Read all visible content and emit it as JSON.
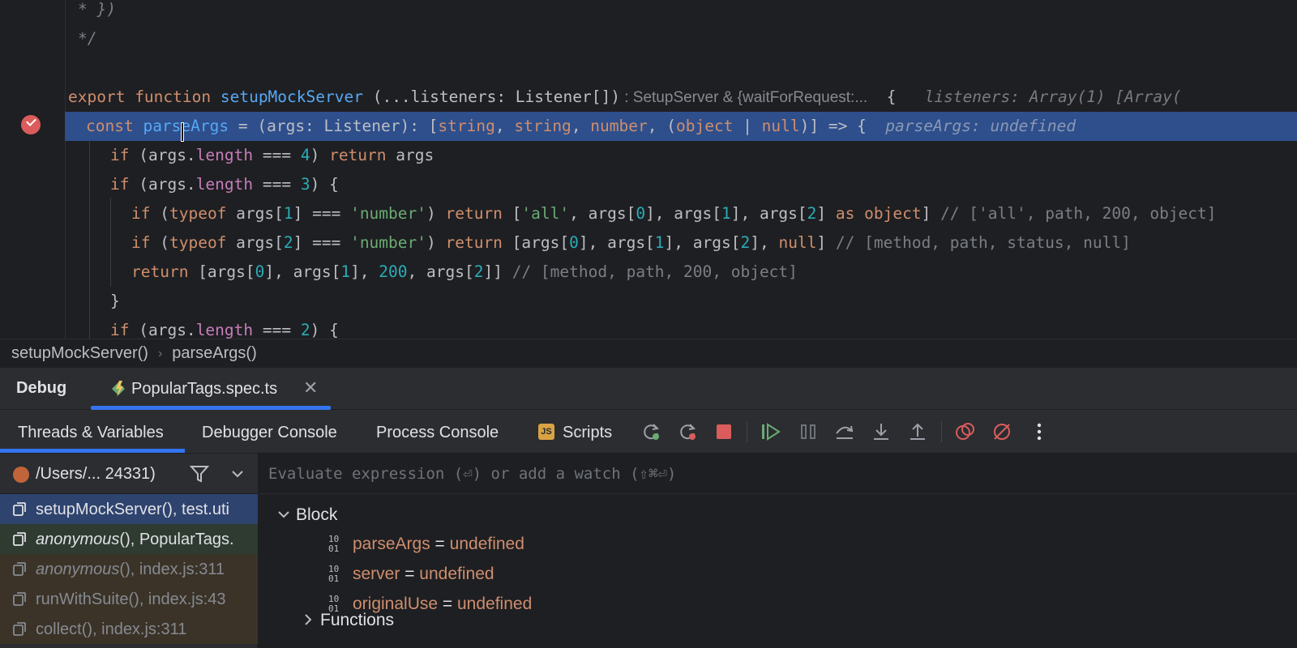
{
  "editor": {
    "lines": [
      {
        "tokens": [
          {
            "t": "* })",
            "c": "cmi"
          }
        ]
      },
      {
        "tokens": [
          {
            "t": "*/",
            "c": "cmi"
          }
        ]
      },
      {
        "tokens": []
      },
      {
        "tokens": [
          {
            "t": "export ",
            "c": "kw"
          },
          {
            "t": "function ",
            "c": "kw"
          },
          {
            "t": "setupMockServer",
            "c": "fn"
          },
          {
            "t": " (...listeners: Listener[])",
            "c": "id"
          },
          {
            "t": " : SetupServer & {waitForRequest:...",
            "c": "inlay"
          },
          {
            "t": "  {",
            "c": "id"
          },
          {
            "t": "   listeners: Array(1) [Array(",
            "c": "dbgval"
          }
        ]
      },
      {
        "tokens": [
          {
            "t": "const ",
            "c": "kw"
          },
          {
            "t": "parseArgs",
            "c": "fn"
          },
          {
            "t": " = ",
            "c": "id"
          },
          {
            "t": "(args: Listener): [",
            "c": "id"
          },
          {
            "t": "string",
            "c": "kw"
          },
          {
            "t": ", ",
            "c": "id"
          },
          {
            "t": "string",
            "c": "kw"
          },
          {
            "t": ", ",
            "c": "id"
          },
          {
            "t": "number",
            "c": "kw"
          },
          {
            "t": ", (",
            "c": "id"
          },
          {
            "t": "object",
            "c": "kw"
          },
          {
            "t": " | ",
            "c": "id"
          },
          {
            "t": "null",
            "c": "kw"
          },
          {
            "t": ")] => {",
            "c": "id"
          },
          {
            "t": "  parseArgs: undefined",
            "c": "dbgval"
          }
        ]
      },
      {
        "tokens": [
          {
            "t": "if ",
            "c": "kw"
          },
          {
            "t": "(args.",
            "c": "id"
          },
          {
            "t": "length",
            "c": "prop"
          },
          {
            "t": " === ",
            "c": "id"
          },
          {
            "t": "4",
            "c": "num"
          },
          {
            "t": ") ",
            "c": "id"
          },
          {
            "t": "return ",
            "c": "kw"
          },
          {
            "t": "args",
            "c": "id"
          }
        ]
      },
      {
        "tokens": [
          {
            "t": "if ",
            "c": "kw"
          },
          {
            "t": "(args.",
            "c": "id"
          },
          {
            "t": "length",
            "c": "prop"
          },
          {
            "t": " === ",
            "c": "id"
          },
          {
            "t": "3",
            "c": "num"
          },
          {
            "t": ") {",
            "c": "id"
          }
        ]
      },
      {
        "tokens": [
          {
            "t": "if ",
            "c": "kw"
          },
          {
            "t": "(",
            "c": "id"
          },
          {
            "t": "typeof ",
            "c": "kw"
          },
          {
            "t": "args[",
            "c": "id"
          },
          {
            "t": "1",
            "c": "num"
          },
          {
            "t": "] === ",
            "c": "id"
          },
          {
            "t": "'number'",
            "c": "str"
          },
          {
            "t": ") ",
            "c": "id"
          },
          {
            "t": "return ",
            "c": "kw"
          },
          {
            "t": "[",
            "c": "id"
          },
          {
            "t": "'all'",
            "c": "str"
          },
          {
            "t": ", args[",
            "c": "id"
          },
          {
            "t": "0",
            "c": "num"
          },
          {
            "t": "], args[",
            "c": "id"
          },
          {
            "t": "1",
            "c": "num"
          },
          {
            "t": "], args[",
            "c": "id"
          },
          {
            "t": "2",
            "c": "num"
          },
          {
            "t": "] ",
            "c": "id"
          },
          {
            "t": "as ",
            "c": "kw"
          },
          {
            "t": "object",
            "c": "kw"
          },
          {
            "t": "] ",
            "c": "id"
          },
          {
            "t": "// ['all', path, 200, object]",
            "c": "cm"
          }
        ]
      },
      {
        "tokens": [
          {
            "t": "if ",
            "c": "kw"
          },
          {
            "t": "(",
            "c": "id"
          },
          {
            "t": "typeof ",
            "c": "kw"
          },
          {
            "t": "args[",
            "c": "id"
          },
          {
            "t": "2",
            "c": "num"
          },
          {
            "t": "] === ",
            "c": "id"
          },
          {
            "t": "'number'",
            "c": "str"
          },
          {
            "t": ") ",
            "c": "id"
          },
          {
            "t": "return ",
            "c": "kw"
          },
          {
            "t": "[args[",
            "c": "id"
          },
          {
            "t": "0",
            "c": "num"
          },
          {
            "t": "], args[",
            "c": "id"
          },
          {
            "t": "1",
            "c": "num"
          },
          {
            "t": "], args[",
            "c": "id"
          },
          {
            "t": "2",
            "c": "num"
          },
          {
            "t": "], ",
            "c": "id"
          },
          {
            "t": "null",
            "c": "kw"
          },
          {
            "t": "] ",
            "c": "id"
          },
          {
            "t": "// [method, path, status, null]",
            "c": "cm"
          }
        ]
      },
      {
        "tokens": [
          {
            "t": "return ",
            "c": "kw"
          },
          {
            "t": "[args[",
            "c": "id"
          },
          {
            "t": "0",
            "c": "num"
          },
          {
            "t": "], args[",
            "c": "id"
          },
          {
            "t": "1",
            "c": "num"
          },
          {
            "t": "], ",
            "c": "id"
          },
          {
            "t": "200",
            "c": "num"
          },
          {
            "t": ", args[",
            "c": "id"
          },
          {
            "t": "2",
            "c": "num"
          },
          {
            "t": "]] ",
            "c": "id"
          },
          {
            "t": "// [method, path, 200, object]",
            "c": "cm"
          }
        ]
      },
      {
        "tokens": [
          {
            "t": "}",
            "c": "id"
          }
        ]
      },
      {
        "tokens": [
          {
            "t": "if ",
            "c": "kw"
          },
          {
            "t": "(args.",
            "c": "id"
          },
          {
            "t": "length",
            "c": "prop"
          },
          {
            "t": " === ",
            "c": "id"
          },
          {
            "t": "2",
            "c": "num"
          },
          {
            "t": ") {",
            "c": "id"
          }
        ]
      }
    ]
  },
  "breadcrumb": {
    "item1": "setupMockServer()",
    "item2": "parseArgs()"
  },
  "debug": {
    "title": "Debug",
    "run_tab": "PopularTags.spec.ts",
    "tabs": {
      "threads": "Threads & Variables",
      "console": "Debugger Console",
      "process": "Process Console",
      "scripts": "Scripts"
    },
    "js_badge": "JS",
    "thread_label": "/Users/... 24331)",
    "frames": [
      {
        "italic": "",
        "text": "setupMockServer(), test.uti"
      },
      {
        "italic": "anonymous",
        "text": "(), PopularTags."
      },
      {
        "italic": "anonymous",
        "text": "(), index.js:311"
      },
      {
        "italic": "",
        "text": "runWithSuite(), index.js:43"
      },
      {
        "italic": "",
        "text": "collect(), index.js:311"
      }
    ],
    "eval_placeholder": "Evaluate expression (⏎) or add a watch (⇧⌘⏎)",
    "block_label": "Block",
    "variables": [
      {
        "name": "parseArgs",
        "eq": " = ",
        "value": "undefined"
      },
      {
        "name": "server",
        "eq": " = ",
        "value": "undefined"
      },
      {
        "name": "originalUse",
        "eq": " = ",
        "value": "undefined"
      }
    ],
    "functions_label": "Functions",
    "binary_glyph": "10\n01"
  },
  "colors": {
    "accent": "#3574f0",
    "breakpoint": "#db5c5c",
    "keyword": "#cf8e6d",
    "function": "#56a8f5",
    "number": "#2aacb8",
    "string": "#6aab73"
  }
}
